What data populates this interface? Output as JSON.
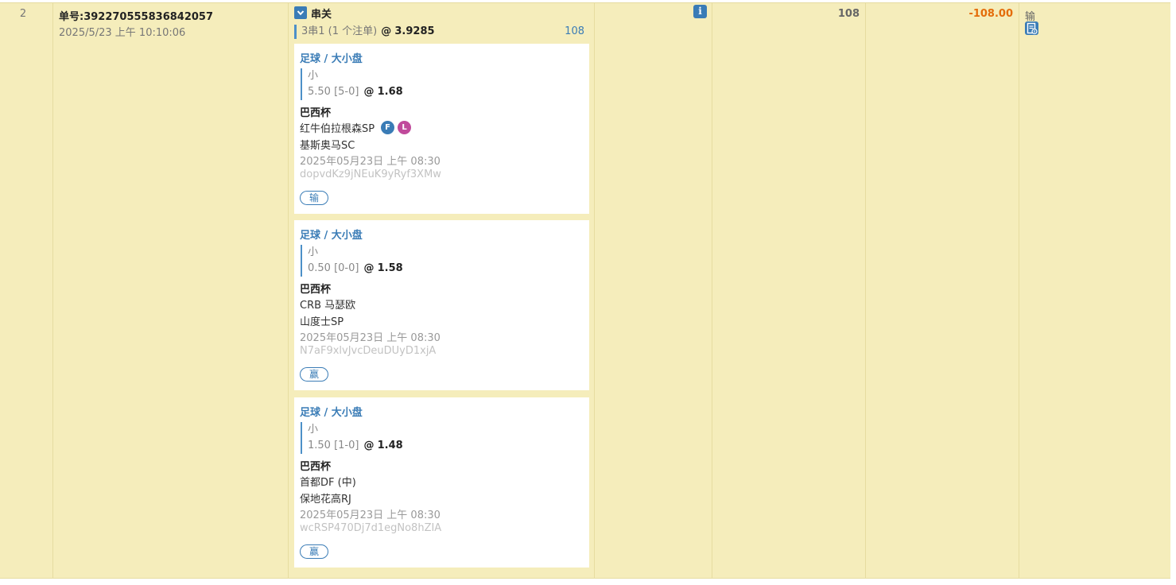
{
  "row": {
    "index": "2",
    "bet_no": "单号:392270555836842057",
    "bet_time": "2025/5/23 上午 10:10:06",
    "parlay": {
      "label": "串关",
      "summary": "3串1 (1 个注单)",
      "at": "@",
      "odds": "3.9285",
      "amount": "108"
    },
    "stake": "108",
    "profit_loss": "-108.00",
    "result": "输",
    "colors": {
      "accent": "#3a7cb6",
      "row_bg": "#f5edbb",
      "loss": "#e46c0a",
      "l_badge": "#c04a9b"
    }
  },
  "legs": [
    {
      "sport": "足球 / 大小盘",
      "pick": "小",
      "line": "5.50 [5-0]",
      "at": "@",
      "odds": "1.68",
      "league": "巴西杯",
      "home": "红牛伯拉根森SP",
      "away": "基斯奥马SC",
      "match_time": "2025年05月23日 上午 08:30",
      "ref": "dopvdKz9jNEuK9yRyf3XMw",
      "result": "输",
      "badges": {
        "f": "F",
        "l": "L"
      }
    },
    {
      "sport": "足球 / 大小盘",
      "pick": "小",
      "line": "0.50 [0-0]",
      "at": "@",
      "odds": "1.58",
      "league": "巴西杯",
      "home": "CRB 马瑟欧",
      "away": "山度士SP",
      "match_time": "2025年05月23日 上午 08:30",
      "ref": "N7aF9xlvJvcDeuDUyD1xjA",
      "result": "赢"
    },
    {
      "sport": "足球 / 大小盘",
      "pick": "小",
      "line": "1.50 [1-0]",
      "at": "@",
      "odds": "1.48",
      "league": "巴西杯",
      "home": "首都DF (中)",
      "away": "保地花高RJ",
      "match_time": "2025年05月23日 上午 08:30",
      "ref": "wcRSP470Dj7d1egNo8hZIA",
      "result": "赢"
    }
  ],
  "icons": {
    "expand": "chevron-down-icon",
    "info": "info-icon",
    "receipt": "receipt-icon"
  }
}
